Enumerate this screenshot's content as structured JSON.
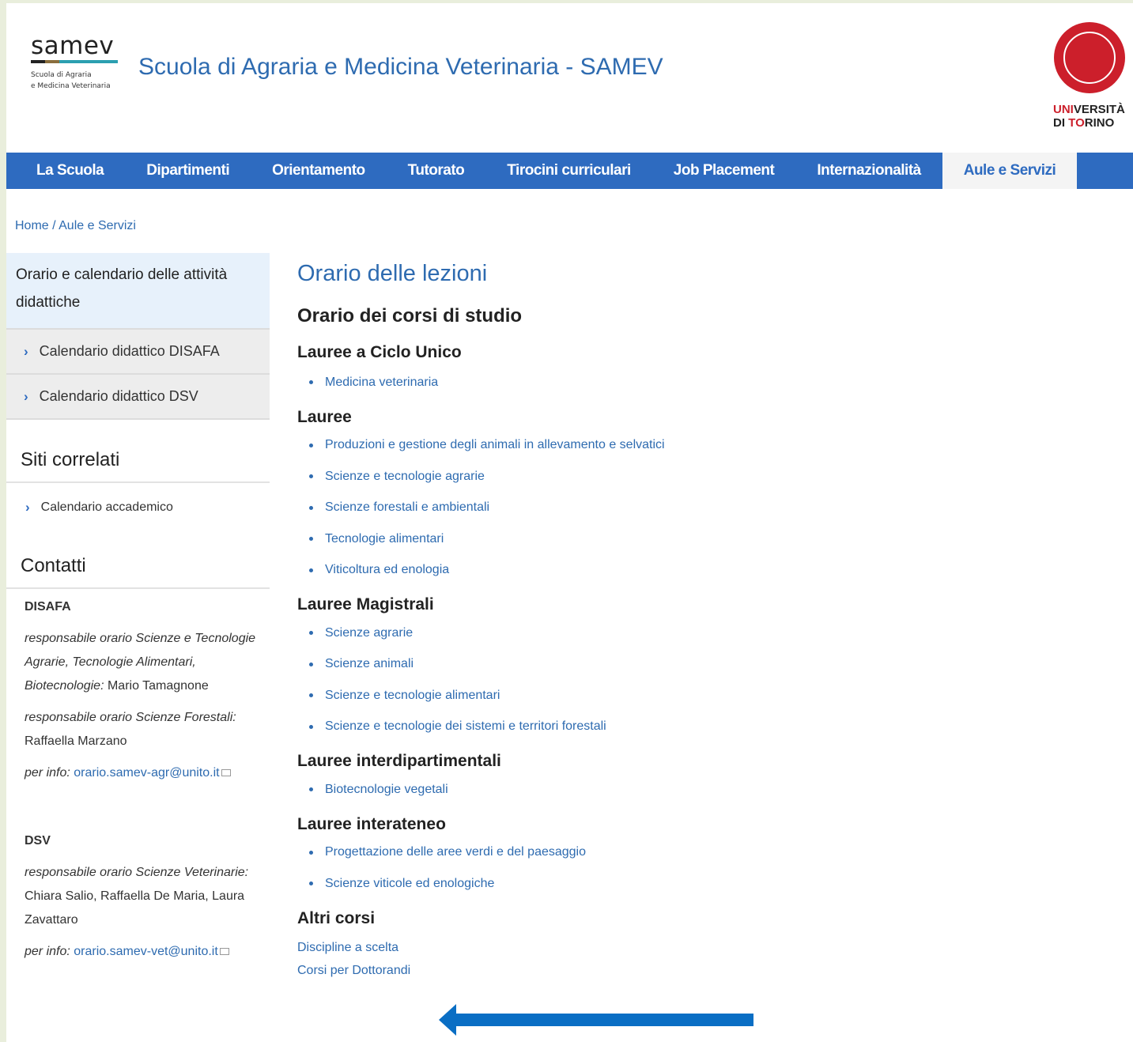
{
  "header": {
    "logo_word": "samev",
    "logo_sub_1": "Scuola di Agraria",
    "logo_sub_2": "e Medicina Veterinaria",
    "site_title": "Scuola di Agraria e Medicina Veterinaria - SAMEV",
    "university_line1_red": "UNI",
    "university_line1_rest": "VERSITÀ",
    "university_line2_a": "DI ",
    "university_line2_red": "TO",
    "university_line2_b": "RINO"
  },
  "nav": {
    "items": [
      "La Scuola",
      "Dipartimenti",
      "Orientamento",
      "Tutorato",
      "Tirocini curriculari",
      "Job Placement",
      "Internazionalità",
      "Aule e Servizi"
    ],
    "active": "Aule e Servizi"
  },
  "breadcrumb": "Home / Aule e Servizi",
  "sidebar": {
    "heading": "Orario e calendario delle attività didattiche",
    "items": [
      "Calendario didattico DISAFA",
      "Calendario didattico DSV"
    ],
    "related_title": "Siti correlati",
    "related_items": [
      "Calendario accademico"
    ],
    "contacts_title": "Contatti",
    "disafa": {
      "name": "DISAFA",
      "p1_italic": "responsabile orario Scienze e Tecnologie Agrarie, Tecnologie Alimentari, Biotecnologie:",
      "p1_name": " Mario Tamagnone",
      "p2_italic": "responsabile orario Scienze Forestali:",
      "p2_name": " Raffaella Marzano",
      "info_label": "per info:",
      "email": "orario.samev-agr@unito.it"
    },
    "dsv": {
      "name": "DSV",
      "p1_italic": "responsabile orario Scienze Veterinarie:",
      "p1_name": " Chiara Salio, Raffaella De Maria, Laura Zavattaro",
      "info_label": "per info:",
      "email": "orario.samev-vet@unito.it"
    }
  },
  "main": {
    "title": "Orario delle lezioni",
    "subtitle": "Orario dei corsi di studio",
    "sections": [
      {
        "title": "Lauree a Ciclo Unico",
        "items": [
          "Medicina veterinaria"
        ]
      },
      {
        "title": "Lauree",
        "items": [
          "Produzioni e gestione degli animali in allevamento e selvatici",
          "Scienze e tecnologie agrarie",
          "Scienze forestali e ambientali",
          "Tecnologie alimentari",
          "Viticoltura ed enologia"
        ]
      },
      {
        "title": "Lauree Magistrali",
        "items": [
          "Scienze agrarie",
          "Scienze animali",
          "Scienze e tecnologie alimentari",
          "Scienze e tecnologie dei sistemi e territori forestali"
        ]
      },
      {
        "title": "Lauree interdipartimentali",
        "items": [
          "Biotecnologie vegetali"
        ]
      },
      {
        "title": "Lauree interateneo",
        "items": [
          "Progettazione delle aree verdi e del paesaggio",
          "Scienze viticole ed enologiche"
        ]
      }
    ],
    "altri_title": "Altri corsi",
    "altri_links": [
      "Discipline a scelta",
      "Corsi per Dottorandi"
    ]
  },
  "colors": {
    "brand_blue": "#2e6bc0",
    "link_blue": "#2e6bb0",
    "unito_red": "#cc1f2b",
    "annotation_arrow": "#0a6ec4"
  }
}
